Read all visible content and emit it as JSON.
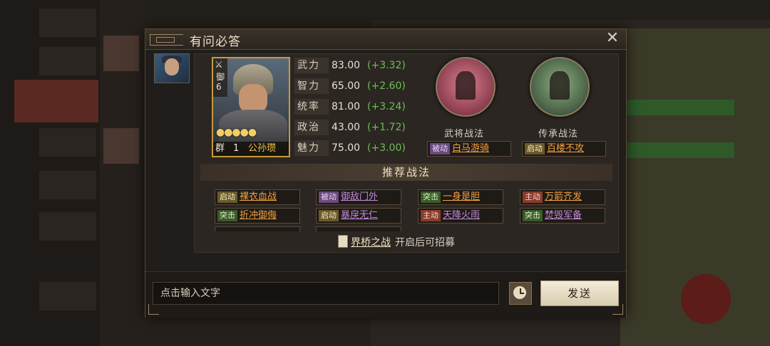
{
  "dialog": {
    "title": "有问必答",
    "close_glyph": "✕"
  },
  "general": {
    "arms_icon": "⚔",
    "arms_type": "御",
    "cost": "6",
    "stars": "●●●●●",
    "faction": "群",
    "level": "1",
    "name": "公孙瓒",
    "stats": [
      {
        "label": "武力",
        "value": "83.00",
        "bonus": "(+3.32)"
      },
      {
        "label": "智力",
        "value": "65.00",
        "bonus": "(+2.60)"
      },
      {
        "label": "统率",
        "value": "81.00",
        "bonus": "(+3.24)"
      },
      {
        "label": "政治",
        "value": "43.00",
        "bonus": "(+1.72)"
      },
      {
        "label": "魅力",
        "value": "75.00",
        "bonus": "(+3.00)"
      }
    ]
  },
  "skills": {
    "self": {
      "title": "武将战法",
      "tag": "被动",
      "name": "白马游骑"
    },
    "inherit": {
      "title": "传承战法",
      "tag": "启动",
      "name": "百楼不攻"
    }
  },
  "recommend": {
    "header": "推荐战法",
    "rows": [
      [
        {
          "tag": "启动",
          "name": "裸衣血战"
        },
        {
          "tag": "被动",
          "name": "御敌门外"
        },
        {
          "tag": "突击",
          "name": "一身是胆"
        },
        {
          "tag": "主动",
          "name": "万箭齐发"
        }
      ],
      [
        {
          "tag": "突击",
          "name": "折冲御侮"
        },
        {
          "tag": "启动",
          "name": "暴戾无仁"
        },
        {
          "tag": "主动",
          "name": "天降火雨"
        },
        {
          "tag": "突击",
          "name": "焚毁军备"
        }
      ]
    ]
  },
  "unlock": {
    "link": "界桥之战",
    "text": "开启后可招募"
  },
  "input": {
    "placeholder": "点击输入文字",
    "send_label": "发送"
  },
  "colors": {
    "accent_gold": "#c89a3c",
    "bonus_green": "#6cbf52",
    "skill_orange": "#f0a040"
  }
}
